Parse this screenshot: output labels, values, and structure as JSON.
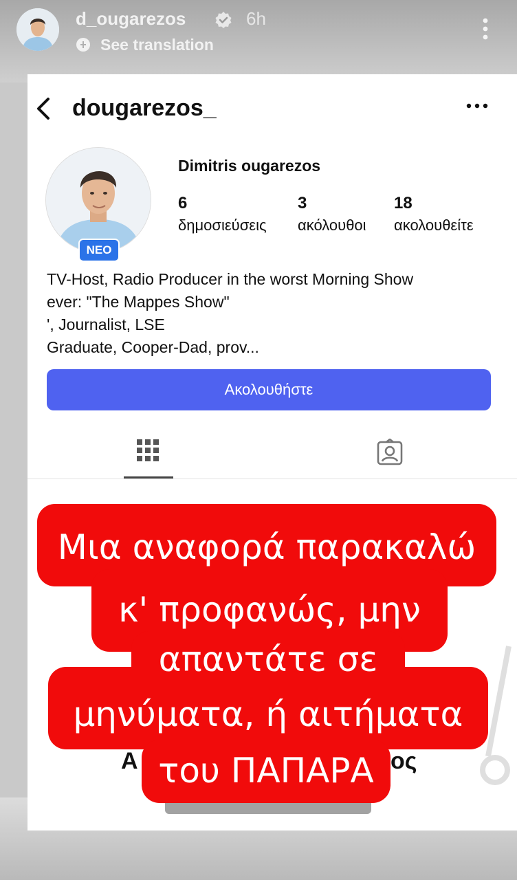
{
  "story": {
    "username": "d_ougarezos",
    "time": "6h",
    "translate_label": "See translation"
  },
  "profile": {
    "username": "dougarezos_",
    "full_name": "Dimitris ougarezos",
    "new_badge": "NEO",
    "stats": [
      {
        "value": "6",
        "label": "δημοσιεύσεις"
      },
      {
        "value": "3",
        "label": "ακόλουθοι"
      },
      {
        "value": "18",
        "label": "ακολουθείτε"
      }
    ],
    "bio_lines": [
      "TV-Host, Radio Producer in the worst Morning Show",
      "ever: \"The Mappes Show\"",
      "', Journalist, LSE",
      "Graduate, Cooper-Dad, prov..."
    ],
    "follow_label": "Ακολουθήστε",
    "covered_text_left": "Α",
    "covered_text_right": "ος"
  },
  "caption": {
    "lines": [
      "Μια αναφορά παρακαλώ",
      "κ' προφανώς, μην",
      "απαντάτε σε",
      "μηνύματα, ή αιτήματα",
      "του ΠΑΠΑΡΑ"
    ],
    "color": "#f10b0b"
  },
  "colors": {
    "follow_button": "#4f62f0",
    "badge": "#2b73e8"
  }
}
